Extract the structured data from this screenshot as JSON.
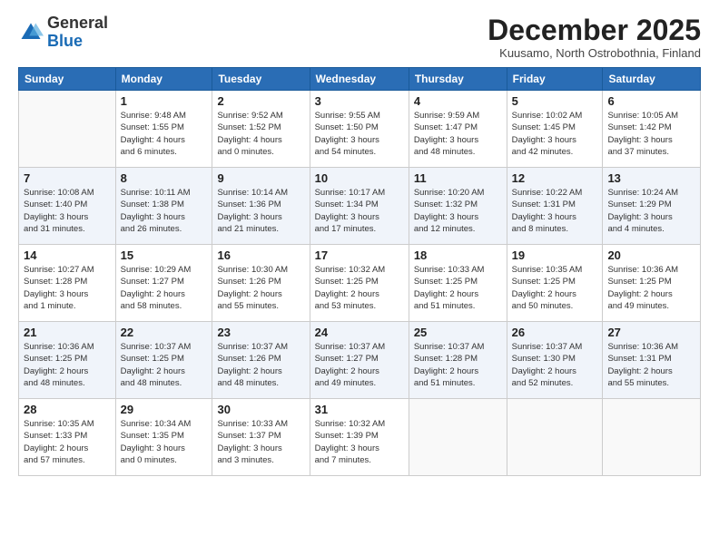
{
  "logo": {
    "general": "General",
    "blue": "Blue"
  },
  "title": "December 2025",
  "location": "Kuusamo, North Ostrobothnia, Finland",
  "headers": [
    "Sunday",
    "Monday",
    "Tuesday",
    "Wednesday",
    "Thursday",
    "Friday",
    "Saturday"
  ],
  "weeks": [
    [
      {
        "day": "",
        "info": ""
      },
      {
        "day": "1",
        "info": "Sunrise: 9:48 AM\nSunset: 1:55 PM\nDaylight: 4 hours\nand 6 minutes."
      },
      {
        "day": "2",
        "info": "Sunrise: 9:52 AM\nSunset: 1:52 PM\nDaylight: 4 hours\nand 0 minutes."
      },
      {
        "day": "3",
        "info": "Sunrise: 9:55 AM\nSunset: 1:50 PM\nDaylight: 3 hours\nand 54 minutes."
      },
      {
        "day": "4",
        "info": "Sunrise: 9:59 AM\nSunset: 1:47 PM\nDaylight: 3 hours\nand 48 minutes."
      },
      {
        "day": "5",
        "info": "Sunrise: 10:02 AM\nSunset: 1:45 PM\nDaylight: 3 hours\nand 42 minutes."
      },
      {
        "day": "6",
        "info": "Sunrise: 10:05 AM\nSunset: 1:42 PM\nDaylight: 3 hours\nand 37 minutes."
      }
    ],
    [
      {
        "day": "7",
        "info": "Sunrise: 10:08 AM\nSunset: 1:40 PM\nDaylight: 3 hours\nand 31 minutes."
      },
      {
        "day": "8",
        "info": "Sunrise: 10:11 AM\nSunset: 1:38 PM\nDaylight: 3 hours\nand 26 minutes."
      },
      {
        "day": "9",
        "info": "Sunrise: 10:14 AM\nSunset: 1:36 PM\nDaylight: 3 hours\nand 21 minutes."
      },
      {
        "day": "10",
        "info": "Sunrise: 10:17 AM\nSunset: 1:34 PM\nDaylight: 3 hours\nand 17 minutes."
      },
      {
        "day": "11",
        "info": "Sunrise: 10:20 AM\nSunset: 1:32 PM\nDaylight: 3 hours\nand 12 minutes."
      },
      {
        "day": "12",
        "info": "Sunrise: 10:22 AM\nSunset: 1:31 PM\nDaylight: 3 hours\nand 8 minutes."
      },
      {
        "day": "13",
        "info": "Sunrise: 10:24 AM\nSunset: 1:29 PM\nDaylight: 3 hours\nand 4 minutes."
      }
    ],
    [
      {
        "day": "14",
        "info": "Sunrise: 10:27 AM\nSunset: 1:28 PM\nDaylight: 3 hours\nand 1 minute."
      },
      {
        "day": "15",
        "info": "Sunrise: 10:29 AM\nSunset: 1:27 PM\nDaylight: 2 hours\nand 58 minutes."
      },
      {
        "day": "16",
        "info": "Sunrise: 10:30 AM\nSunset: 1:26 PM\nDaylight: 2 hours\nand 55 minutes."
      },
      {
        "day": "17",
        "info": "Sunrise: 10:32 AM\nSunset: 1:25 PM\nDaylight: 2 hours\nand 53 minutes."
      },
      {
        "day": "18",
        "info": "Sunrise: 10:33 AM\nSunset: 1:25 PM\nDaylight: 2 hours\nand 51 minutes."
      },
      {
        "day": "19",
        "info": "Sunrise: 10:35 AM\nSunset: 1:25 PM\nDaylight: 2 hours\nand 50 minutes."
      },
      {
        "day": "20",
        "info": "Sunrise: 10:36 AM\nSunset: 1:25 PM\nDaylight: 2 hours\nand 49 minutes."
      }
    ],
    [
      {
        "day": "21",
        "info": "Sunrise: 10:36 AM\nSunset: 1:25 PM\nDaylight: 2 hours\nand 48 minutes."
      },
      {
        "day": "22",
        "info": "Sunrise: 10:37 AM\nSunset: 1:25 PM\nDaylight: 2 hours\nand 48 minutes."
      },
      {
        "day": "23",
        "info": "Sunrise: 10:37 AM\nSunset: 1:26 PM\nDaylight: 2 hours\nand 48 minutes."
      },
      {
        "day": "24",
        "info": "Sunrise: 10:37 AM\nSunset: 1:27 PM\nDaylight: 2 hours\nand 49 minutes."
      },
      {
        "day": "25",
        "info": "Sunrise: 10:37 AM\nSunset: 1:28 PM\nDaylight: 2 hours\nand 51 minutes."
      },
      {
        "day": "26",
        "info": "Sunrise: 10:37 AM\nSunset: 1:30 PM\nDaylight: 2 hours\nand 52 minutes."
      },
      {
        "day": "27",
        "info": "Sunrise: 10:36 AM\nSunset: 1:31 PM\nDaylight: 2 hours\nand 55 minutes."
      }
    ],
    [
      {
        "day": "28",
        "info": "Sunrise: 10:35 AM\nSunset: 1:33 PM\nDaylight: 2 hours\nand 57 minutes."
      },
      {
        "day": "29",
        "info": "Sunrise: 10:34 AM\nSunset: 1:35 PM\nDaylight: 3 hours\nand 0 minutes."
      },
      {
        "day": "30",
        "info": "Sunrise: 10:33 AM\nSunset: 1:37 PM\nDaylight: 3 hours\nand 3 minutes."
      },
      {
        "day": "31",
        "info": "Sunrise: 10:32 AM\nSunset: 1:39 PM\nDaylight: 3 hours\nand 7 minutes."
      },
      {
        "day": "",
        "info": ""
      },
      {
        "day": "",
        "info": ""
      },
      {
        "day": "",
        "info": ""
      }
    ]
  ]
}
